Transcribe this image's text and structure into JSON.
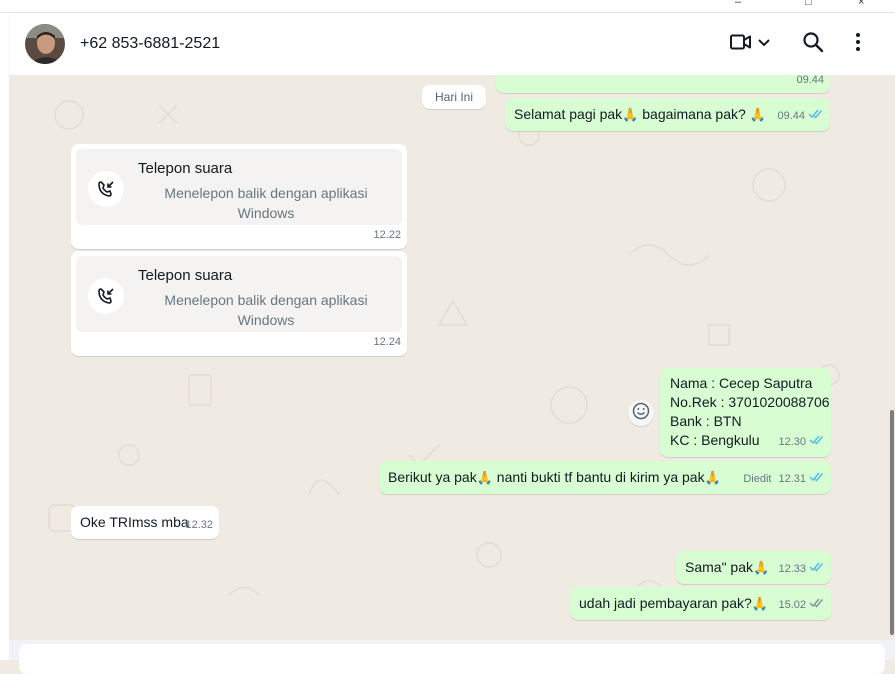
{
  "window": {
    "controls": [
      "–",
      "□",
      "×"
    ]
  },
  "header": {
    "contact_name": "+62 853-6881-2521",
    "icons": [
      "video-call-icon",
      "chevron-down-icon",
      "search-icon",
      "more-options-icon"
    ]
  },
  "chat": {
    "date_chip": "Hari Ini",
    "messages": [
      {
        "dir": "out",
        "time": "09.44",
        "status": "read"
      },
      {
        "dir": "out",
        "text_before": "Selamat pagi pak",
        "emoji1": "🙏",
        "text_mid": " bagaimana pak? ",
        "emoji2": "🙏",
        "time": "09.44",
        "status": "read"
      },
      {
        "dir": "in",
        "type": "call",
        "title": "Telepon suara",
        "subtitle": "Menelepon balik dengan aplikasi Windows",
        "time": "12.22"
      },
      {
        "dir": "in",
        "type": "call",
        "title": "Telepon suara",
        "subtitle": "Menelepon balik dengan aplikasi Windows",
        "time": "12.24"
      },
      {
        "dir": "out",
        "lines": [
          "Nama : Cecep Saputra",
          "No.Rek : 3701020088706",
          "Bank : BTN",
          "KC : Bengkulu"
        ],
        "time": "12.30",
        "status": "read"
      },
      {
        "dir": "out",
        "text_before": "Berikut ya pak",
        "emoji1": "🙏",
        "text_mid": " nanti bukti tf bantu di kirim ya pak",
        "emoji2": "🙏",
        "edited": "Diedit",
        "time": "12.31",
        "status": "read"
      },
      {
        "dir": "in",
        "text": "Oke TRImss mba",
        "time": "12.32"
      },
      {
        "dir": "out",
        "text_before": "Sama\" pak",
        "emoji1": "🙏",
        "time": "12.33",
        "status": "read"
      },
      {
        "dir": "out",
        "text_before": "udah jadi pembayaran pak?",
        "emoji1": "🙏",
        "time": "15.02",
        "status": "delivered"
      }
    ]
  },
  "colors": {
    "outgoing_bubble": "#d9fdd3",
    "incoming_bubble": "#ffffff",
    "read_tick": "#53bdeb",
    "delivered_tick": "#8696a0",
    "chat_background": "#efeae2"
  }
}
